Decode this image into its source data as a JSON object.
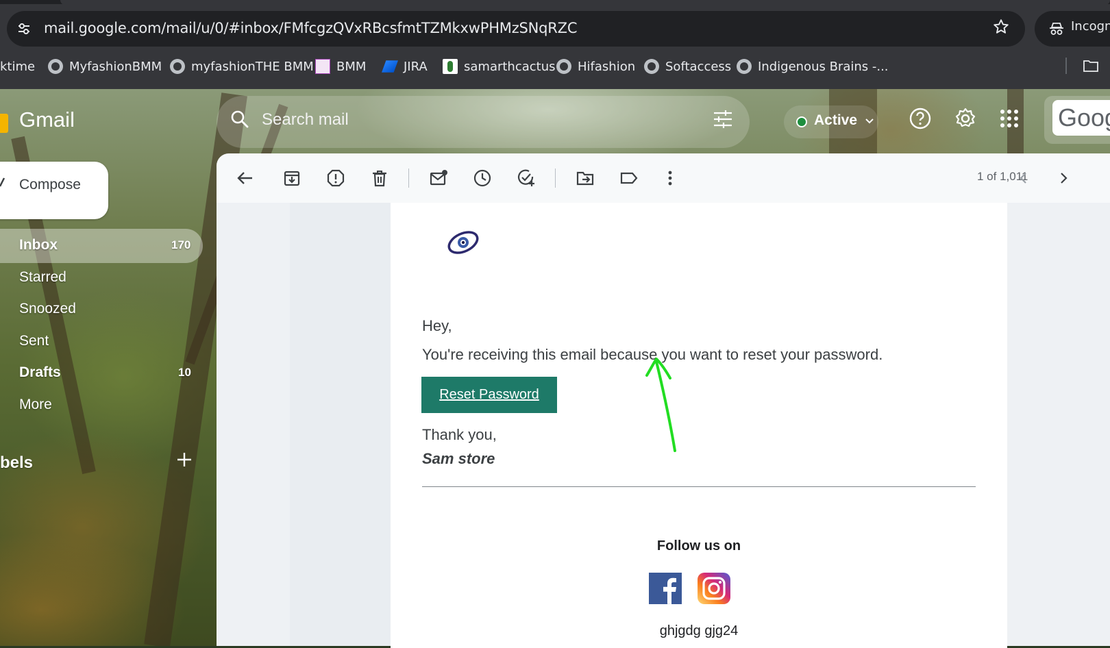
{
  "browser": {
    "url": "mail.google.com/mail/u/0/#inbox/FMfcgzQVxRBcsfmtTZMkxwPHMzSNqRZC",
    "incognito_label": "Incogn",
    "bookmarks": [
      {
        "label": "ktime",
        "icon": "none"
      },
      {
        "label": "MyfashionBMM",
        "icon": "globe-icon"
      },
      {
        "label": "myfashionTHE BMM",
        "icon": "globe-icon"
      },
      {
        "label": "BMM",
        "icon": "bmm-favicon"
      },
      {
        "label": "JIRA",
        "icon": "jira-icon"
      },
      {
        "label": "samarthcactus",
        "icon": "cactus-favicon"
      },
      {
        "label": "Hifashion",
        "icon": "globe-icon"
      },
      {
        "label": "Softaccess",
        "icon": "globe-icon"
      },
      {
        "label": "Indigenous Brains -...",
        "icon": "globe-icon"
      }
    ]
  },
  "gmail": {
    "logo_text": "Gmail",
    "search_placeholder": "Search mail",
    "status": "Active",
    "account_text": "Goog",
    "compose_label": "Compose",
    "nav": [
      {
        "label": "Inbox",
        "count": "170",
        "bold": true
      },
      {
        "label": "Starred",
        "count": "",
        "bold": false
      },
      {
        "label": "Snoozed",
        "count": "",
        "bold": false
      },
      {
        "label": "Sent",
        "count": "",
        "bold": false
      },
      {
        "label": "Drafts",
        "count": "10",
        "bold": true
      },
      {
        "label": "More",
        "count": "",
        "bold": false
      }
    ],
    "labels_heading": "bels",
    "pager": "1 of 1,011"
  },
  "email": {
    "greeting": "Hey,",
    "body": "You're receiving this email because you want to reset your password.",
    "button_label": "Reset Password",
    "thanks": "Thank you,",
    "signature": "Sam store",
    "follow": "Follow us on",
    "footer": "ghjgdg gjg24"
  },
  "colors": {
    "button": "#1e7a68",
    "annotation": "#22dd22",
    "active_dot": "#1e8e3e"
  }
}
